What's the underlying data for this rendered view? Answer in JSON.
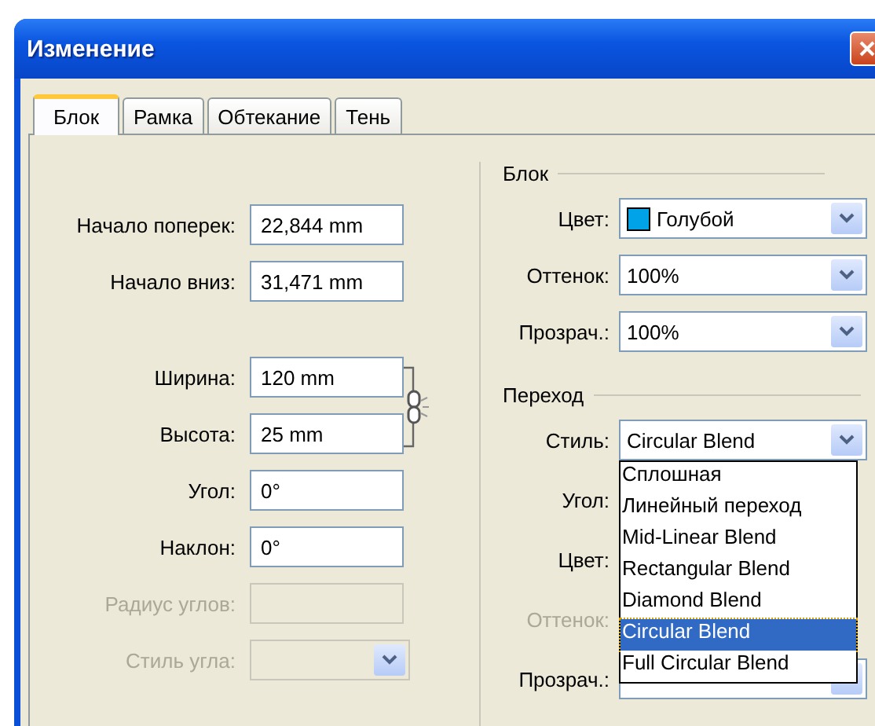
{
  "window": {
    "title": "Изменение"
  },
  "tabs": [
    {
      "label": "Блок",
      "selected": true
    },
    {
      "label": "Рамка",
      "selected": false
    },
    {
      "label": "Обтекание",
      "selected": false
    },
    {
      "label": "Тень",
      "selected": false
    }
  ],
  "left_sections": [
    {
      "linked": false,
      "rows": [
        {
          "label": "Начало поперек:",
          "kind": "field",
          "value": "22,844 mm",
          "disabled": false
        },
        {
          "label": "Начало вниз:",
          "kind": "field",
          "value": "31,471 mm",
          "disabled": false
        }
      ]
    },
    {
      "linked": true,
      "rows": [
        {
          "label": "Ширина:",
          "kind": "field",
          "value": "120 mm",
          "disabled": false
        },
        {
          "label": "Высота:",
          "kind": "field",
          "value": "25 mm",
          "disabled": false
        },
        {
          "label": "Угол:",
          "kind": "field",
          "value": "0°",
          "disabled": false
        },
        {
          "label": "Наклон:",
          "kind": "field",
          "value": "0°",
          "disabled": false
        },
        {
          "label": "Радиус углов:",
          "kind": "field",
          "disabled": true
        },
        {
          "label": "Стиль угла:",
          "kind": "dropdown",
          "disabled": true
        }
      ]
    }
  ],
  "right_groups": [
    {
      "title": "Блок",
      "rows": [
        {
          "label": "Цвет:",
          "kind": "color-dropdown",
          "value": "Голубой",
          "color": "#00a2e8",
          "disabled": false
        },
        {
          "label": "Оттенок:",
          "kind": "dropdown",
          "value": "100%",
          "disabled": false
        },
        {
          "label": "Прозрач.:",
          "kind": "dropdown",
          "value": "100%",
          "disabled": false
        }
      ]
    },
    {
      "title": "Переход",
      "rows": [
        {
          "label": "Стиль:",
          "kind": "open-dropdown",
          "value": "Circular Blend",
          "disabled": false,
          "options": [
            {
              "label": "Сплошная",
              "selected": false
            },
            {
              "label": "Линейный переход",
              "selected": false
            },
            {
              "label": "Mid-Linear Blend",
              "selected": false
            },
            {
              "label": "Rectangular Blend",
              "selected": false
            },
            {
              "label": "Diamond Blend",
              "selected": false
            },
            {
              "label": "Circular Blend",
              "selected": true
            },
            {
              "label": "Full Circular Blend",
              "selected": false
            }
          ]
        },
        {
          "label": "Угол:",
          "kind": "covered",
          "disabled": false
        },
        {
          "label": "Цвет:",
          "kind": "covered",
          "disabled": false
        },
        {
          "label": "Оттенок:",
          "kind": "covered",
          "disabled": true
        },
        {
          "label": "Прозрач.:",
          "kind": "covered-dropdown",
          "disabled": false
        }
      ]
    }
  ]
}
